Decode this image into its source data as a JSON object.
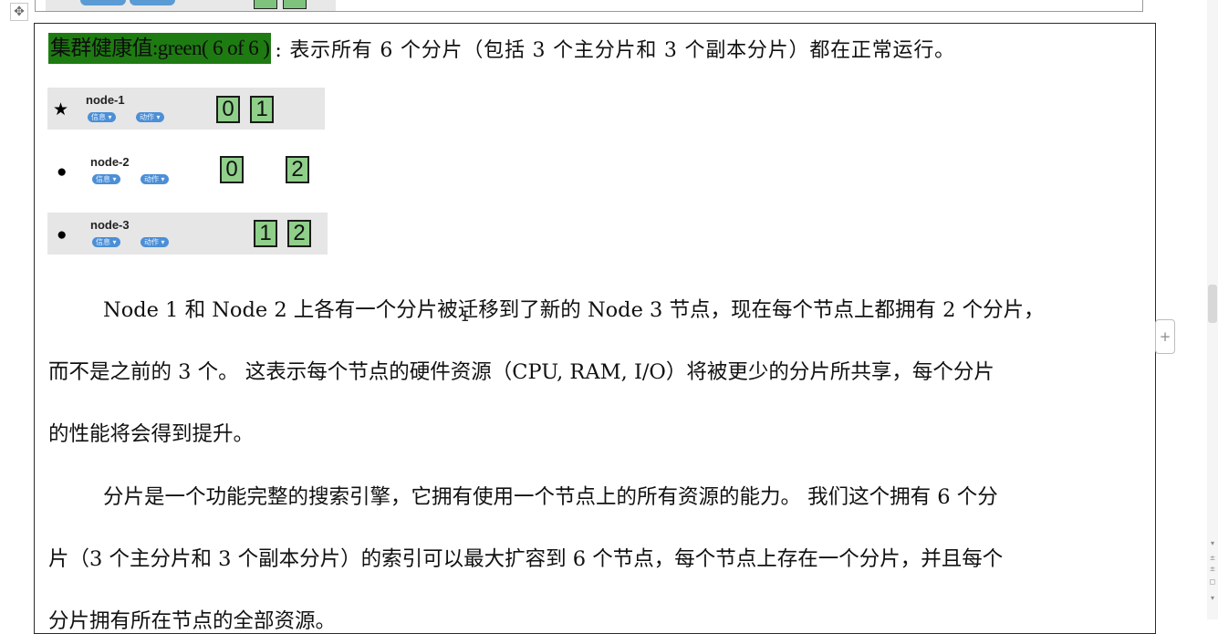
{
  "toolbar": {
    "move_handle_icon": "move-icon",
    "move_glyph": "✥"
  },
  "health_line": {
    "highlight": "集群健康值:green( 6 of 6 )",
    "rest": ": 表示所有 6 个分片（包括 3 个主分片和 3 个副本分片）都在正常运行。"
  },
  "nodes": [
    {
      "icon": "★",
      "name": "node-1",
      "info": "信息",
      "action": "动作",
      "shards": [
        "0",
        "1"
      ]
    },
    {
      "icon": "●",
      "name": "node-2",
      "info": "信息",
      "action": "动作",
      "shards": [
        "0",
        "2"
      ]
    },
    {
      "icon": "●",
      "name": "node-3",
      "info": "信息",
      "action": "动作",
      "shards": [
        "1",
        "2"
      ]
    }
  ],
  "paragraphs": [
    "Node 1  和  Node 2  上各有一个分片被迁移到了新的  Node 3  节点，现在每个节点上都拥有 2 个分片，",
    "而不是之前的 3 个。  这表示每个节点的硬件资源（CPU, RAM, I/O）将被更少的分片所共享，每个分片",
    "的性能将会得到提升。",
    "分片是一个功能完整的搜索引擎，它拥有使用一个节点上的所有资源的能力。 我们这个拥有 6 个分",
    "片（3 个主分片和 3 个副本分片）的索引可以最大扩容到 6 个节点，每个节点上存在一个分片，并且每个",
    "分片拥有所在节点的全部资源。"
  ],
  "side": {
    "add_glyph": "+",
    "scroll_glyphs": [
      "▾",
      "±",
      "±",
      "◻",
      "▾"
    ]
  },
  "colors": {
    "highlight": "#1e7b12",
    "shard": "#8fcf8a",
    "pill": "#4b8fd6"
  }
}
